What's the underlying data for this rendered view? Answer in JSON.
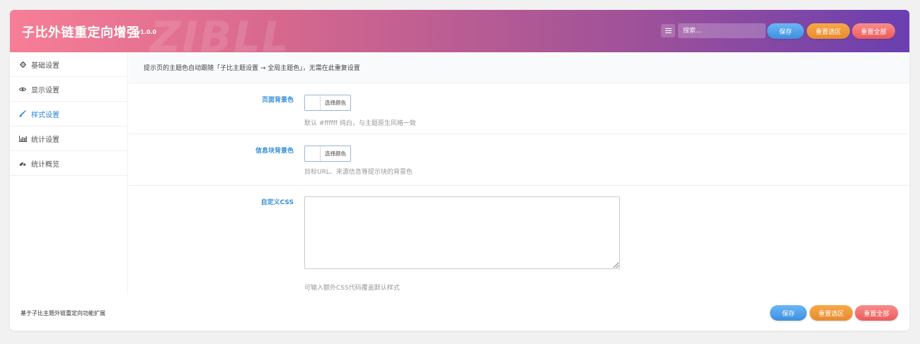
{
  "header": {
    "title": "子比外链重定向增强",
    "version": "v1.0.0",
    "watermark": "ZIBLL",
    "search_placeholder": "搜索...",
    "save_label": "保存",
    "reset_section_label": "重置选区",
    "reset_all_label": "重置全部",
    "gradient_start": "#f77e96",
    "gradient_end": "#6a3fb0"
  },
  "sidebar": {
    "items": [
      {
        "label": "基础设置",
        "icon": "gear-icon"
      },
      {
        "label": "显示设置",
        "icon": "eye-icon"
      },
      {
        "label": "样式设置",
        "icon": "brush-icon",
        "active": true
      },
      {
        "label": "统计设置",
        "icon": "bar-chart-icon"
      },
      {
        "label": "统计概览",
        "icon": "dashboard-icon"
      }
    ]
  },
  "content": {
    "notice": "提示页的主题色自动跟随「子比主题设置 → 全局主题色」，无需在此重复设置",
    "fields": [
      {
        "label": "页面背景色",
        "button": "选择颜色",
        "desc": "默认 #ffffff 纯白，与主题原生风格一致"
      },
      {
        "label": "信息块背景色",
        "button": "选择颜色",
        "desc": "目标URL、来源信息等提示块的背景色"
      },
      {
        "label": "自定义CSS",
        "desc": "可输入额外CSS代码覆盖默认样式"
      }
    ]
  },
  "footer": {
    "text": "基于子比主题外链重定向功能扩展",
    "save_label": "保存",
    "reset_section_label": "重置选区",
    "reset_all_label": "重置全部"
  },
  "colors": {
    "accent": "#2a86d9",
    "save": "#4a9ee6",
    "reset_section": "#f0973b",
    "reset_all": "#f06a6a"
  }
}
